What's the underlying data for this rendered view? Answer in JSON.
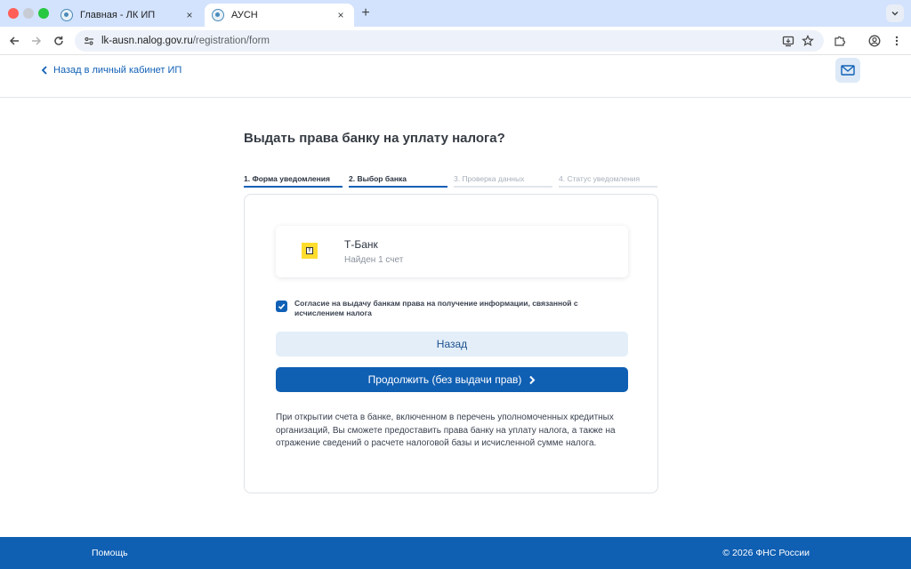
{
  "browser": {
    "tabs": [
      {
        "title": "Главная - ЛК ИП",
        "active": false
      },
      {
        "title": "АУСН",
        "active": true
      }
    ],
    "new_tab_symbol": "+",
    "close_symbol": "×",
    "url_host": "lk-ausn.nalog.gov.ru",
    "url_path": "/registration/form"
  },
  "header": {
    "back_link": "Назад в личный кабинет ИП",
    "mail_icon": "mail-icon"
  },
  "page": {
    "title": "Выдать права банку на уплату налога?"
  },
  "steps": [
    {
      "label": "1. Форма уведомления",
      "state": "active"
    },
    {
      "label": "2. Выбор банка",
      "state": "active"
    },
    {
      "label": "3. Проверка данных",
      "state": "inactive"
    },
    {
      "label": "4. Статус уведомления",
      "state": "inactive"
    }
  ],
  "bank": {
    "name": "Т-Банк",
    "accounts": "Найден 1 счет",
    "logo_color": "#ffdd2d"
  },
  "consent": {
    "checked": true,
    "text": "Согласие на выдачу банкам права на получение информации, связанной с исчислением налога"
  },
  "buttons": {
    "back": "Назад",
    "continue": "Продолжить (без выдачи прав)"
  },
  "info": {
    "text": "При открытии счета в банке, включенном в перечень уполномоченных кредитных организаций, Вы сможете предоставить права банку на уплату налога, а также на отражение сведений о расчете налоговой базы и исчисленной сумме налога."
  },
  "footer": {
    "help": "Помощь",
    "copyright": "© 2026 ФНС России"
  },
  "colors": {
    "accent": "#0f5fb3",
    "secondary_button": "#e3eef9",
    "tabbar": "#d3e3fd"
  }
}
